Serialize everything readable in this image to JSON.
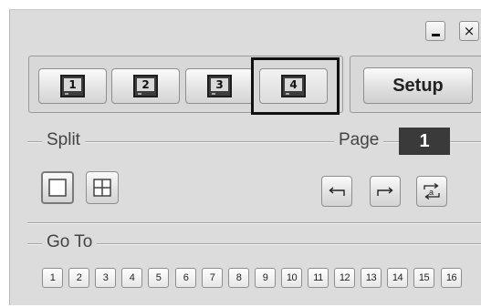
{
  "window": {
    "minimize_label": "_",
    "close_label": "×"
  },
  "screens": [
    {
      "label": "1",
      "icon": "monitor-icon",
      "active": false
    },
    {
      "label": "2",
      "icon": "monitor-icon",
      "active": false
    },
    {
      "label": "3",
      "icon": "monitor-icon",
      "active": false
    },
    {
      "label": "4",
      "icon": "monitor-icon",
      "active": true
    }
  ],
  "setup": {
    "label": "Setup"
  },
  "split": {
    "label": "Split",
    "options": [
      {
        "name": "single-view",
        "icon": "single-view-icon",
        "selected": true
      },
      {
        "name": "quad-view",
        "icon": "quad-grid-icon",
        "selected": false
      }
    ]
  },
  "page": {
    "label": "Page",
    "value": "1",
    "controls": [
      {
        "name": "previous-page",
        "icon": "arrow-left-icon"
      },
      {
        "name": "next-page",
        "icon": "arrow-right-icon"
      },
      {
        "name": "auto-cycle",
        "icon": "cycle-sequence-icon",
        "icon_text": "a"
      }
    ]
  },
  "goto": {
    "label": "Go To",
    "numbers": [
      "1",
      "2",
      "3",
      "4",
      "5",
      "6",
      "7",
      "8",
      "9",
      "10",
      "11",
      "12",
      "13",
      "14",
      "15",
      "16"
    ]
  },
  "colors": {
    "panel_bg": "#dcdcdc",
    "page_box_bg": "#3a3a3a",
    "highlight_border": "#111111"
  }
}
